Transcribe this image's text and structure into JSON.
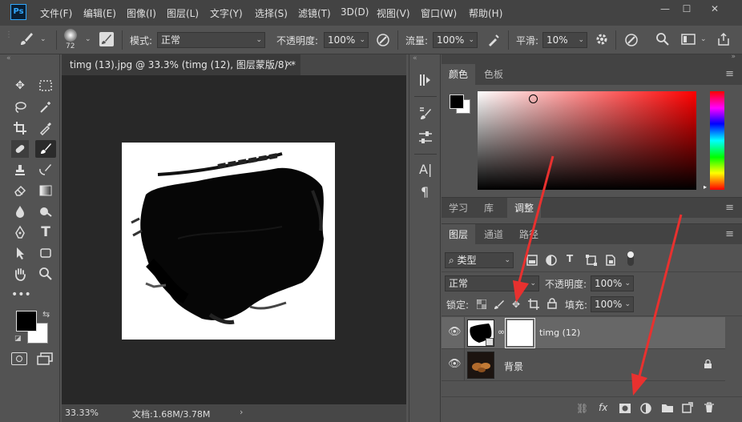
{
  "app": {
    "logo": "Ps"
  },
  "menu": [
    "文件(F)",
    "编辑(E)",
    "图像(I)",
    "图层(L)",
    "文字(Y)",
    "选择(S)",
    "滤镜(T)",
    "3D(D)",
    "视图(V)",
    "窗口(W)",
    "帮助(H)"
  ],
  "window_controls": {
    "minimize": "—",
    "maximize": "☐",
    "close": "✕"
  },
  "options": {
    "brush_size": "72",
    "mode_label": "模式:",
    "mode_value": "正常",
    "opacity_label": "不透明度:",
    "opacity_value": "100%",
    "flow_label": "流量:",
    "flow_value": "100%",
    "smooth_label": "平滑:",
    "smooth_value": "10%"
  },
  "document": {
    "tab_title": "timg (13).jpg @ 33.3% (timg (12), 图层蒙版/8) *",
    "close": "✕",
    "zoom": "33.33%",
    "doc_info": "文档:1.68M/3.78M",
    "status_arrow": "›"
  },
  "color_panel": {
    "tabs": [
      "颜色",
      "色板"
    ],
    "active": 0
  },
  "adjust_panel": {
    "tabs": [
      "学习",
      "库",
      "调整"
    ],
    "active": 2
  },
  "layers_panel": {
    "tabs": [
      "图层",
      "通道",
      "路径"
    ],
    "active": 0,
    "filter_label": "类型",
    "blend_mode": "正常",
    "opacity_label": "不透明度:",
    "opacity_value": "100%",
    "lock_label": "锁定:",
    "fill_label": "填充:",
    "fill_value": "100%",
    "layers": [
      {
        "name": "timg (12)",
        "selected": true,
        "visible": true
      },
      {
        "name": "背景",
        "selected": false,
        "visible": true,
        "locked": true
      }
    ],
    "footer_icons": [
      "link-icon",
      "fx-icon",
      "mask-icon",
      "adjustment-icon",
      "folder-icon",
      "new-layer-icon",
      "trash-icon"
    ],
    "fx_label": "fx"
  },
  "side_strip": {
    "text_icon": "A|",
    "para_icon": "¶"
  },
  "colors": {
    "accent": "#31a8ff",
    "arrow": "#e8312f",
    "foreground": "#000000",
    "background": "#ffffff"
  }
}
